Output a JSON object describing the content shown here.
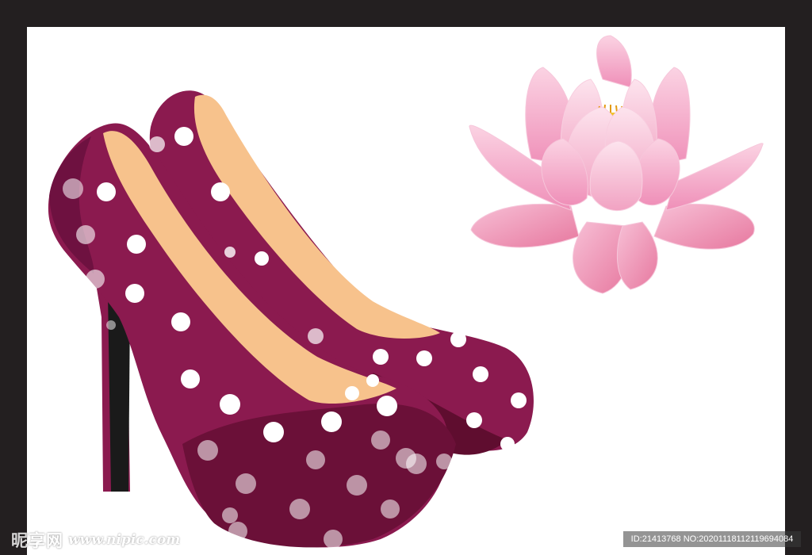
{
  "watermark": {
    "brand": "昵享网",
    "site": "www.nipic.com",
    "id_text": "ID:21413768 NO:20201118112119694084"
  },
  "colors": {
    "frame": "#231f20",
    "background": "#ffffff",
    "shoe_body": "#8b1a4f",
    "shoe_shadow": "#5f0d2f",
    "shoe_lining": "#f7c28c",
    "heel": "#1a1a1a",
    "lotus_pink": "#f4a8c8",
    "lotus_stamen": "#f2c12e"
  },
  "illustration": {
    "left_object": "polka-dot high-heel shoes",
    "right_object": "pink lotus flower"
  }
}
